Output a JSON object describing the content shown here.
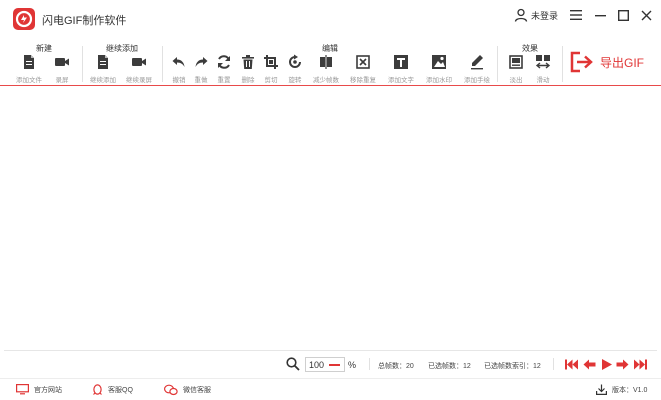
{
  "window": {
    "title": "闪电GIF制作软件",
    "user_label": "未登录"
  },
  "toolbar": {
    "groups": {
      "new": "新建",
      "continue_add": "继续添加",
      "edit": "编辑",
      "effects": "效果"
    },
    "tools": {
      "add_file": "添加文件",
      "record": "录屏",
      "continue_add": "继续添加",
      "continue_record": "继续录屏",
      "undo": "撤销",
      "redo": "重做",
      "reset": "重置",
      "delete": "删除",
      "crop": "剪切",
      "rotate": "旋转",
      "reduce_frames": "减少帧数",
      "remove_duplicates": "移除重复",
      "add_text": "添加文字",
      "add_watermark": "添加水印",
      "add_handwriting": "添加手绘",
      "fade": "淡出",
      "slide": "滑动"
    },
    "export_label": "导出GIF"
  },
  "status": {
    "zoom_value": "100",
    "zoom_unit": "%",
    "total_frames": "总帧数：20",
    "selected_frames": "已选帧数：12",
    "selected_index": "已选帧数索引：12"
  },
  "footer": {
    "website": "官方网站",
    "qq_support": "客服QQ",
    "wechat_support": "微信客服",
    "version": "版本：V1.0"
  },
  "colors": {
    "brand": "#e03535",
    "icon_dark": "#3c3c3c",
    "label_gray": "#9a9a9a"
  }
}
